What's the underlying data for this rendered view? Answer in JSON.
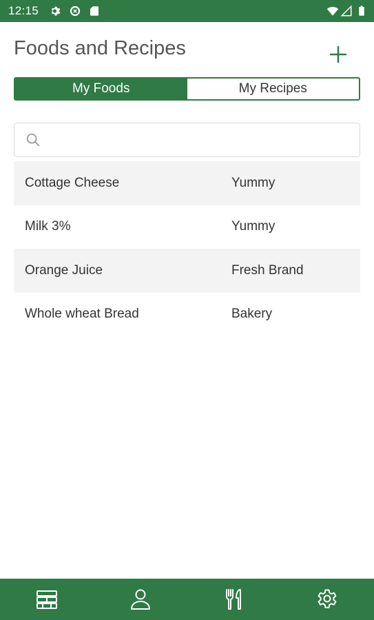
{
  "status_bar": {
    "time": "12:15",
    "icons": [
      "gear-icon",
      "sync-icon",
      "sd-card-icon",
      "wifi-icon",
      "signal-icon",
      "battery-icon"
    ]
  },
  "header": {
    "title": "Foods and Recipes",
    "add_icon": "plus-icon"
  },
  "tabs": [
    {
      "label": "My Foods",
      "active": true
    },
    {
      "label": "My Recipes",
      "active": false
    }
  ],
  "search": {
    "placeholder": "",
    "value": "",
    "icon": "search-icon"
  },
  "foods": [
    {
      "name": "Cottage Cheese",
      "brand": "Yummy"
    },
    {
      "name": "Milk 3%",
      "brand": "Yummy"
    },
    {
      "name": "Orange Juice",
      "brand": "Fresh Brand"
    },
    {
      "name": "Whole wheat Bread",
      "brand": "Bakery"
    }
  ],
  "bottom_nav": [
    {
      "icon": "journal-icon"
    },
    {
      "icon": "profile-icon"
    },
    {
      "icon": "utensils-icon"
    },
    {
      "icon": "settings-icon"
    }
  ],
  "colors": {
    "primary": "#2f7a45",
    "row_shade": "#f3f3f3",
    "text": "#333333",
    "title": "#555555"
  }
}
